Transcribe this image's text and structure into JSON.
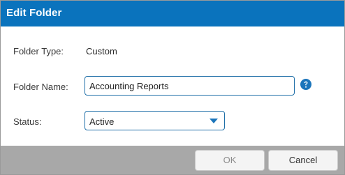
{
  "dialog": {
    "title": "Edit Folder"
  },
  "form": {
    "folder_type": {
      "label": "Folder Type:",
      "value": "Custom"
    },
    "folder_name": {
      "label": "Folder Name:",
      "value": "Accounting Reports",
      "help_icon": "question-circle-icon"
    },
    "status": {
      "label": "Status:",
      "selected": "Active",
      "chevron_icon": "chevron-down-icon"
    }
  },
  "footer": {
    "ok_label": "OK",
    "cancel_label": "Cancel"
  },
  "colors": {
    "title_bar": "#0a73bd",
    "accent": "#1b75bb",
    "footer": "#a8a8a8",
    "disabled_text": "#8c8c8c"
  }
}
